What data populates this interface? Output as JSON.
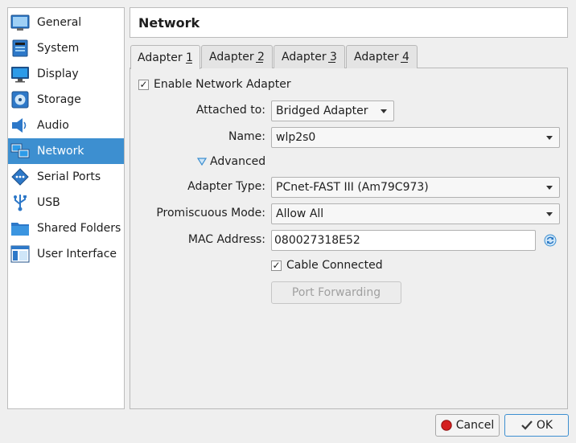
{
  "sidebar": {
    "items": [
      {
        "label": "General",
        "icon": "general-icon"
      },
      {
        "label": "System",
        "icon": "system-icon"
      },
      {
        "label": "Display",
        "icon": "display-icon"
      },
      {
        "label": "Storage",
        "icon": "storage-icon"
      },
      {
        "label": "Audio",
        "icon": "audio-icon"
      },
      {
        "label": "Network",
        "icon": "network-icon",
        "selected": true
      },
      {
        "label": "Serial Ports",
        "icon": "serial-ports-icon"
      },
      {
        "label": "USB",
        "icon": "usb-icon"
      },
      {
        "label": "Shared Folders",
        "icon": "shared-folders-icon"
      },
      {
        "label": "User Interface",
        "icon": "user-interface-icon"
      }
    ]
  },
  "header": {
    "title": "Network"
  },
  "tabs": [
    {
      "label": "Adapter 1",
      "active": true
    },
    {
      "label": "Adapter 2"
    },
    {
      "label": "Adapter 3"
    },
    {
      "label": "Adapter 4"
    }
  ],
  "form": {
    "enable_adapter": {
      "label": "Enable Network Adapter",
      "checked": true
    },
    "attached_to": {
      "label": "Attached to:",
      "value": "Bridged Adapter"
    },
    "name": {
      "label": "Name:",
      "value": "wlp2s0"
    },
    "advanced": {
      "label": "Advanced"
    },
    "adapter_type": {
      "label": "Adapter Type:",
      "value": "PCnet-FAST III (Am79C973)"
    },
    "promiscuous_mode": {
      "label": "Promiscuous Mode:",
      "value": "Allow All"
    },
    "mac_address": {
      "label": "MAC Address:",
      "value": "080027318E52"
    },
    "cable_connected": {
      "label": "Cable Connected",
      "checked": true
    },
    "port_forwarding": {
      "label": "Port Forwarding"
    }
  },
  "buttons": {
    "cancel": "Cancel",
    "ok": "OK"
  },
  "colors": {
    "selection": "#3d8fd0",
    "background": "#efefef",
    "cancel_icon": "#d42020"
  }
}
